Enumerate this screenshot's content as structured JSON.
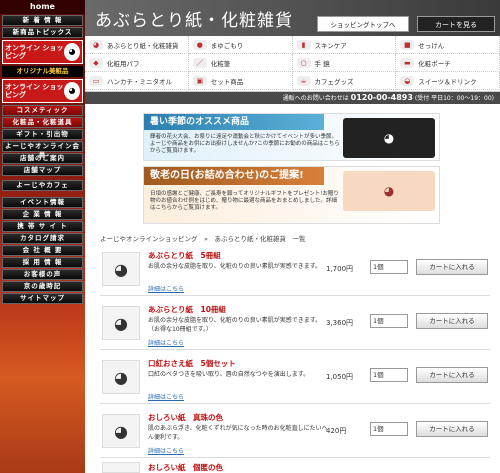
{
  "sidebar": {
    "home": "home",
    "items": [
      "新 着 情 報",
      "新商品トピックス"
    ],
    "online_shop": "オンライン ショッピング",
    "original": "オリジナル美粧品",
    "online_shop2": "オンライン ショッピング",
    "cosmetic": "コスメティック",
    "cosmetic_sub": "化粧品・化粧道具",
    "links": [
      "ギフト・引出物",
      "よーじやオンライン会員",
      "店舗のご案内",
      "店舗マップ"
    ],
    "cafe": "よーじやカフェ",
    "links2": [
      "イベント情報",
      "企 業 情 報",
      "携 帯 サ イ ト",
      "カタログ請求",
      "会 社 概 要",
      "採 用 情 報",
      "お客様の声",
      "京の歳時記",
      "サイトマップ"
    ]
  },
  "header": {
    "title": "あぶらとり紙・化粧雑貨",
    "shop_top": "ショッピングトップへ",
    "cart": "カートを見る"
  },
  "categories": [
    "あぶらとり紙・化粧雑貨",
    "まゆごもり",
    "スキンケア",
    "せっけん",
    "化粧用パフ",
    "化粧筆",
    "手 鏡",
    "化粧ポーチ",
    "ハンカチ・ミニタオル",
    "セット商品",
    "カフェグッズ",
    "スイーツ＆ドリンク"
  ],
  "phone": {
    "label": "通販へのお問い合わせは",
    "number": "0120-00-4893",
    "hours": "(受付 平日10：00～19：00)"
  },
  "banner1": {
    "title": "暑い季節のオススメ商品",
    "body": "輝者の花火大会、お祭りに遠足や運動会と秋にかけてイベントが多い季節。よーじや商品をお供にお出掛けしませんか?この季節にお勧めの商品はこちらからご覧頂けます。"
  },
  "banner2": {
    "title": "敬老の日(お詰め合わせ)のご提案!",
    "body": "日頃の感謝とご健康、ご長寿を願ってオリジナルギフトをプレゼント!お贈り物のお値合わせ例をはじめ、贈り物に最適な商品をおまとめしました。詳細はこちらからご覧頂けます。"
  },
  "breadcrumb": "よーじやオンラインショッピング　»　あぶらとり紙・化粧雑貨　一覧",
  "products": [
    {
      "name": "あぶらとり紙　5冊組",
      "desc": "お肌の余分な皮脂を取り、化粧のりの良い素肌が実感できます。",
      "link": "詳細はこちら",
      "price": "1,700円",
      "qty": "1個",
      "add": "カートに入れる"
    },
    {
      "name": "あぶらとり紙　10冊組",
      "desc": "お肌の余分な皮脂を取り、化粧のりの良い素肌が実感できます。（お得な10冊組です。）",
      "link": "詳細はこちら",
      "price": "3,360円",
      "qty": "1個",
      "add": "カートに入れる"
    },
    {
      "name": "口紅おさえ紙　5個セット",
      "desc": "口紅のベタつきを吸い取り、唇の自然なつやを演出します。",
      "link": "詳細はこちら",
      "price": "1,050円",
      "qty": "1個",
      "add": "カートに入れる"
    },
    {
      "name": "おしろい紙　真珠の色",
      "desc": "肌のあぶら浮き、化粧くずれが気になった時のお化粧直しにたいへん便利です。",
      "link": "詳細はこちら",
      "price": "420円",
      "qty": "1個",
      "add": "カートに入れる"
    },
    {
      "name": "おしろい紙　個匿の色",
      "desc": "",
      "link": "",
      "price": "",
      "qty": "",
      "add": ""
    }
  ]
}
